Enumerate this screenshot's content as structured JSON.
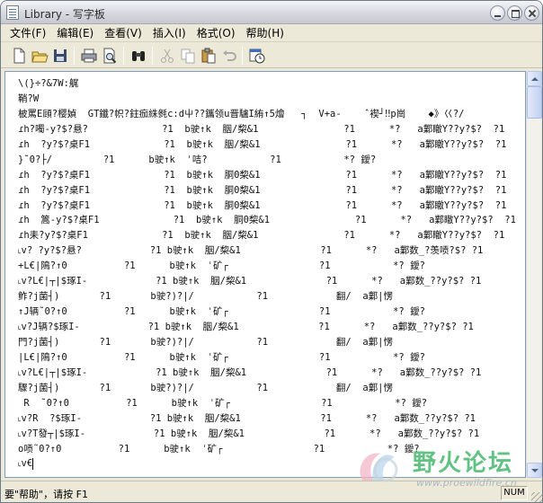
{
  "window": {
    "title": "Library - 写字板"
  },
  "menu": [
    {
      "label": "文件(F)",
      "name": "menu-file"
    },
    {
      "label": "编辑(E)",
      "name": "menu-edit"
    },
    {
      "label": "查看(V)",
      "name": "menu-view"
    },
    {
      "label": "插入(I)",
      "name": "menu-insert"
    },
    {
      "label": "格式(O)",
      "name": "menu-format"
    },
    {
      "label": "帮助(H)",
      "name": "menu-help"
    }
  ],
  "toolbar": [
    {
      "icon": "new-document-icon"
    },
    {
      "icon": "open-folder-icon"
    },
    {
      "icon": "save-disk-icon"
    },
    {
      "icon": "print-icon"
    },
    {
      "icon": "print-preview-icon"
    },
    {
      "icon": "find-binoculars-icon"
    },
    {
      "icon": "cut-scissors-icon"
    },
    {
      "icon": "copy-icon"
    },
    {
      "icon": "paste-icon"
    },
    {
      "icon": "undo-icon"
    },
    {
      "icon": "insert-datetime-icon"
    }
  ],
  "document": {
    "lines": [
      "\\(}÷?&7W:艉",
      "鞘?W",
      "柀罵E頋?樱媜  GT鑯?帜?鉒痂絑毿c:d屮??鑴领u晋驢I絠↑5燴   ┐  V+a-    ˆ褉┘‼p崗    ◆》巜?/",
      "ɾh?噣-y?$?悬?             ?1  b驶↑k  胭/棃&1               ?1      *?   a鄴瞮Y??y?$?  ?1",
      "ɾh  ?y?$?桌F1             ?1  b驶↑k  胭/棃&1               ?1      *?   a鄴瞮Y??y?$?  ?1",
      "}˜0?├/         ?1      b驶↑k  ˈ咭?           ?1           *? 鑀?",
      "ɾh  ?y?$?桌F1             ?1  b驶↑k  胴0棃&1               ?1      *?   a鄴瞮Y??y?$?  ?1",
      "ɾh  ?y?$?桌F1             ?1  b驶↑k  胴0棃&1               ?1      *?   a鄴瞮Y??y?$?  ?1",
      "ɾh  ?y?$?桌F1             ?1  b驶↑k  胴0棃&1               ?1      *?   a鄴瞮Y??y?$?  ?1",
      "ɾh  篙-y?$?桌F1             ?1  b驶↑k  胴0棃&1               ?1      *?   a鄴瞮Y??y?$?  ?1",
      "ɾh耒?y?$?桌F1             ?1  b驶↑k  胭/棃&1               ?1      *?   a鄴瞮Y??y?$?  ?1",
      "˪v? ?y?$?悬?            ?1 b驶↑k  胭/棃&1              ?1      *?   a鄴数_?羡唝?$? ?1",
      "+L€|隝?↑0          ?1      b驶↑k  ˈ矿┌                ?1           *? 鑀?",
      "˪v?L€|┬|$琢I-            ?1 b驶↑k  胭/棃&1              ?1      *?   a鄴数_??y?$? ?1",
      "鲊?j菌┤)       ?1       b驶?)?|/           ?1            翻/  a鄴|愣",
      "↑J辆˜0?↑0          ?1      b驶↑k  ˈ矿┌                ?1           *? 鑀?",
      "˪v?J辆?$琢I-            ?1 b驶↑k  胭/棃&1              ?1      *?   a鄴数_??y?$? ?1",
      "門?j菌┤)       ?1       b驶?)?|/           ?1            翻/  a鄴|愣",
      "|L€|隝?↑0          ?1      b驶↑k  ˈ矿┌                ?1           *? 鑀?",
      "˪v?L€|┬|$琢I-            ?1 b驶↑k  胭/棃&1              ?1      *?   a鄴数_??y?$? ?1",
      "驟?j菌┤)       ?1       b驶?)?|/           ?1            翻/  a鄴|愣",
      " R  ˜0?↑0          ?1      b驶↑k  ˈ矿┌                ?1           *? 鑀?",
      "˪v?R  ?$琢I-            ?1 b驶↑k  胭/棃&1              ?1      *?   a鄴数_??y?$? ?1",
      "˪v?T發┬|$琢I-            ?1 b驶↑k  胭/棃&1              ?1      *?   a鄴数_??y?$? ?1",
      "o唝˜0?↑0          ?1      b驶↑k  ˈ矿┌                ?1           *? 鑀?",
      "˪v€"
    ]
  },
  "statusbar": {
    "text": "要\"帮助\"，请按 F1",
    "num": "NUM"
  },
  "watermark": {
    "title": "野火论坛",
    "url": "www.proewildfire.cn"
  }
}
